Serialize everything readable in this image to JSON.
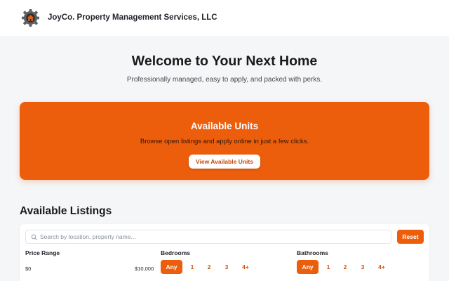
{
  "header": {
    "company_name": "JoyCo. Property Management Services, LLC",
    "logo_icon": "gear-house-logo-icon"
  },
  "hero": {
    "title": "Welcome to Your Next Home",
    "subtitle": "Professionally managed, easy to apply, and packed with perks."
  },
  "banner": {
    "title": "Available Units",
    "subtitle": "Browse open listings and apply online in just a few clicks.",
    "button_label": "View Available Units"
  },
  "listings": {
    "section_title": "Available Listings",
    "search": {
      "placeholder": "Search by location, property name...",
      "value": ""
    },
    "reset_label": "Reset",
    "price": {
      "label": "Price Range",
      "min_label": "$0",
      "max_label": "$10,000"
    },
    "bedrooms": {
      "label": "Bedrooms",
      "options": [
        "Any",
        "1",
        "2",
        "3",
        "4+"
      ],
      "selected": "Any"
    },
    "bathrooms": {
      "label": "Bathrooms",
      "options": [
        "Any",
        "1",
        "2",
        "3",
        "4+"
      ],
      "selected": "Any"
    }
  },
  "colors": {
    "accent": "#ec5e0c",
    "page_bg": "#f4f6f8"
  }
}
